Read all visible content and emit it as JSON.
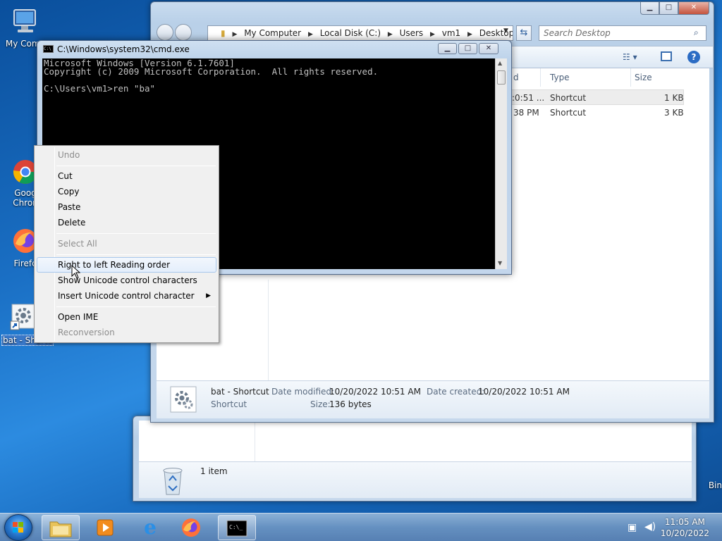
{
  "desktop": {
    "icons": [
      {
        "label": "My Comp",
        "icon": "computer-icon"
      },
      {
        "label": "Goog",
        "label2": "Chron",
        "icon": "chrome-icon"
      },
      {
        "label": "Firefo",
        "icon": "firefox-icon"
      },
      {
        "label": "bat - Shortcut",
        "icon": "settings-shortcut-icon"
      },
      {
        "label": "Bin",
        "icon": "recycle-bin-icon"
      }
    ]
  },
  "explorer": {
    "breadcrumbs": [
      "My Computer",
      "Local Disk (C:)",
      "Users",
      "vm1",
      "Desktop"
    ],
    "search_placeholder": "Search Desktop",
    "columns": {
      "date": "d",
      "type": "Type",
      "size": "Size"
    },
    "rows": [
      {
        "date": ":0:51 ...",
        "type": "Shortcut",
        "size": "1 KB"
      },
      {
        "date": "38 PM",
        "type": "Shortcut",
        "size": "3 KB"
      }
    ],
    "details": {
      "name": "bat - Shortcut",
      "kind": "Shortcut",
      "date_modified_label": "Date modified:",
      "date_modified": "10/20/2022 10:51 AM",
      "date_created_label": "Date created:",
      "date_created": "10/20/2022 10:51 AM",
      "size_label": "Size:",
      "size": "136 bytes"
    }
  },
  "recycle_window": {
    "status": "1 item"
  },
  "cmd": {
    "title": "C:\\Windows\\system32\\cmd.exe",
    "lines": [
      "Microsoft Windows [Version 6.1.7601]",
      "Copyright (c) 2009 Microsoft Corporation.  All rights reserved.",
      "",
      "C:\\Users\\vm1>ren \"ba\""
    ]
  },
  "context_menu": {
    "items": [
      {
        "label": "Undo",
        "disabled": true
      },
      {
        "label": "Cut",
        "disabled": false
      },
      {
        "label": "Copy",
        "disabled": false
      },
      {
        "label": "Paste",
        "disabled": false
      },
      {
        "label": "Delete",
        "disabled": false
      },
      {
        "label": "Select All",
        "disabled": true
      },
      {
        "label": "Right to left Reading order",
        "disabled": false,
        "hover": true
      },
      {
        "label": "Show Unicode control characters",
        "disabled": false
      },
      {
        "label": "Insert Unicode control character",
        "disabled": false,
        "submenu": true
      },
      {
        "label": "Open IME",
        "disabled": false
      },
      {
        "label": "Reconversion",
        "disabled": true
      }
    ]
  },
  "taskbar": {
    "time": "11:05 AM",
    "date": "10/20/2022"
  },
  "colors": {
    "accent": "#1a6fc4",
    "menu_hover": "#e4eefb",
    "cmd_bg": "#000000",
    "cmd_text": "#c0c0c0"
  }
}
